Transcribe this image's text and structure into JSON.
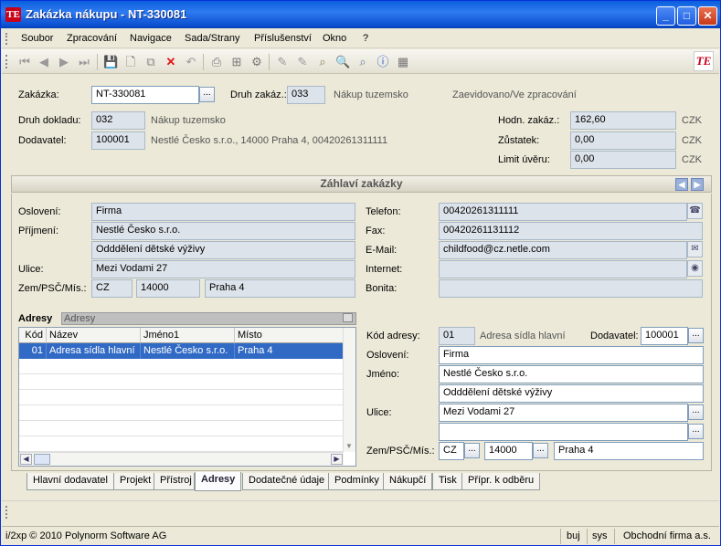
{
  "window": {
    "title": "Zakázka nákupu - NT-330081",
    "app_icon": "TE"
  },
  "menu": [
    "Soubor",
    "Zpracování",
    "Navigace",
    "Sada/Strany",
    "Příslušenství",
    "Okno",
    "?"
  ],
  "header": {
    "zakazka_label": "Zakázka:",
    "zakazka_value": "NT-330081",
    "druh_zakaz_label": "Druh zakáz.:",
    "druh_zakaz_value": "033",
    "druh_zakaz_text": "Nákup tuzemsko",
    "status_text": "Zaevidovano/Ve zpracování",
    "druh_dokladu_label": "Druh dokladu:",
    "druh_dokladu_value": "032",
    "druh_dokladu_text": "Nákup tuzemsko",
    "dodavatel_label": "Dodavatel:",
    "dodavatel_value": "100001",
    "dodavatel_text": "Nestlé Česko s.r.o., 14000 Praha 4, 00420261311111",
    "hodn_label": "Hodn. zakáz.:",
    "hodn_value": "162,60",
    "hodn_cur": "CZK",
    "zustatek_label": "Zůstatek:",
    "zustatek_value": "0,00",
    "zustatek_cur": "CZK",
    "limit_label": "Limit úvěru:",
    "limit_value": "0,00",
    "limit_cur": "CZK"
  },
  "section": {
    "title": "Záhlaví zakázky"
  },
  "contact": {
    "osloveni_label": "Oslovení:",
    "osloveni": "Firma",
    "prijmeni_label": "Příjmení:",
    "prijmeni": "Nestlé Česko s.r.o.",
    "prijmeni2": "Odddělení dětské výživy",
    "ulice_label": "Ulice:",
    "ulice": "Mezi Vodami 27",
    "zem_label": "Zem/PSČ/Mís.:",
    "zem": "CZ",
    "psc": "14000",
    "misto": "Praha 4",
    "telefon_label": "Telefon:",
    "telefon": "00420261311111",
    "fax_label": "Fax:",
    "fax": "00420261131112",
    "email_label": "E-Mail:",
    "email": "childfood@cz.netle.com",
    "internet_label": "Internet:",
    "internet": "",
    "bonita_label": "Bonita:",
    "bonita": ""
  },
  "adresy": {
    "title": "Adresy",
    "subtitle": "Adresy",
    "columns": [
      "Kód",
      "Název",
      "Jméno1",
      "Místo"
    ],
    "rows": [
      {
        "kod": "01",
        "nazev": "Adresa sídla hlavní",
        "jmeno1": "Nestlé Česko s.r.o.",
        "misto": "Praha 4"
      }
    ]
  },
  "detail": {
    "kod_label": "Kód adresy:",
    "kod": "01",
    "kod_text": "Adresa sídla hlavní",
    "dodavatel_label": "Dodavatel:",
    "dodavatel": "100001",
    "osloveni_label": "Oslovení:",
    "osloveni": "Firma",
    "jmeno_label": "Jméno:",
    "jmeno1": "Nestlé Česko s.r.o.",
    "jmeno2": "Odddělení dětské výživy",
    "ulice_label": "Ulice:",
    "ulice1": "Mezi Vodami 27",
    "ulice2": "",
    "zem_label": "Zem/PSČ/Mís.:",
    "zem": "CZ",
    "psc": "14000",
    "misto": "Praha 4"
  },
  "tabs": [
    {
      "label": "Hlavní dodavatel",
      "active": false
    },
    {
      "label": "Projekt",
      "active": false
    },
    {
      "label": "Přístroj",
      "active": false
    },
    {
      "label": "Adresy",
      "active": true
    },
    {
      "label": "Dodatečné údaje",
      "active": false
    },
    {
      "label": "Podmínky",
      "active": false
    },
    {
      "label": "Nákupčí",
      "active": false
    },
    {
      "label": "Tisk",
      "active": false
    },
    {
      "label": "Přípr. k odběru",
      "active": false
    }
  ],
  "status": {
    "left": "i/2xp © 2010 Polynorm Software AG",
    "user": "buj",
    "db": "sys",
    "company": "Obchodní firma a.s."
  }
}
